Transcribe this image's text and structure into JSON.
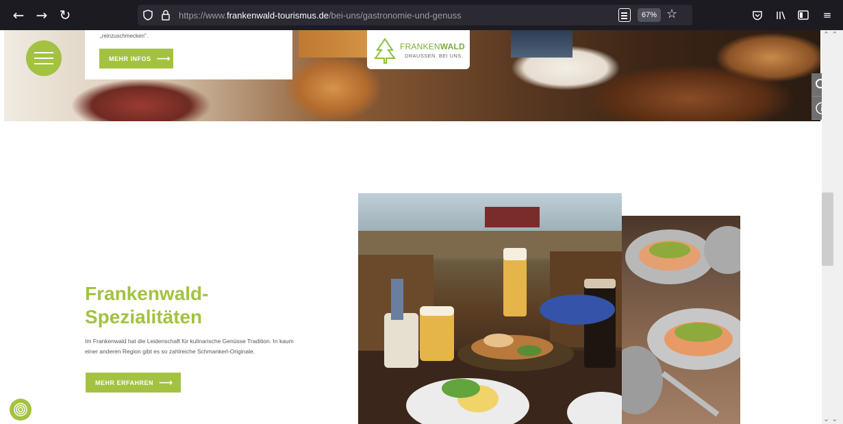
{
  "browser": {
    "url_prefix": "https://www.",
    "url_domain": "frankenwald-tourismus.de",
    "url_path": "/bei-uns/gastronomie-und-genuss",
    "zoom": "67%"
  },
  "hero": {
    "card_text": "„reinzuschmecken\".",
    "cta_label": "MEHR INFOS"
  },
  "logo": {
    "name_light": "FRANKEN",
    "name_bold": "WALD",
    "tagline": "DRAUSSEN. BEI UNS."
  },
  "section": {
    "heading": "Frankenwald-Spezialitäten",
    "body": "Im Frankenwald hat die Leidenschaft für kulinarische Genüsse Tradition. In kaum einer anderen Region gibt es so zahlreiche Schmankerl-Originale.",
    "cta_label": "MEHR ERFAHREN"
  },
  "colors": {
    "accent": "#a3c241",
    "toolbar": "#1c1b22",
    "urlbar": "#2b2a33"
  },
  "icons": [
    "arrow-left-icon",
    "arrow-right-icon",
    "reload-icon",
    "shield-icon",
    "lock-icon",
    "reader-icon",
    "star-icon",
    "pocket-icon",
    "library-icon",
    "sidebar-icon",
    "hamburger-icon",
    "search-icon",
    "info-icon",
    "fingerprint-icon"
  ]
}
